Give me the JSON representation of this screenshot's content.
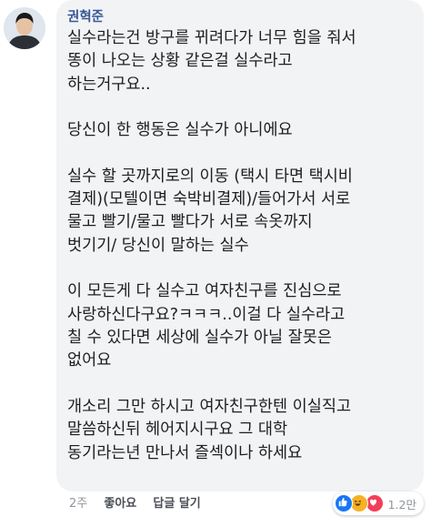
{
  "comment": {
    "author": "권혁준",
    "paragraphs": [
      [
        "실수라는건 방구를 뀌려다가 너무 힘을 줘서",
        "똥이 나오는 상황 같은걸 실수라고",
        "하는거구요.."
      ],
      [
        "당신이 한 행동은 실수가 아니에요"
      ],
      [
        "실수 할 곳까지로의 이동 (택시 타면 택시비",
        "결제)(모텔이면 숙박비결제)/들어가서 서로",
        "물고 빨기/물고 빨다가 서로 속옷까지",
        "벗기기/ 당신이 말하는 실수"
      ],
      [
        "이 모든게 다 실수고 여자친구를 진심으로",
        "사랑하신다구요?ㅋㅋㅋ..이걸 다 실수라고",
        "칠 수 있다면 세상에 실수가 아닐 잘못은",
        "없어요"
      ],
      [
        "개소리 그만 하시고 여자친구한텐 이실직고",
        "말씀하신뒤 헤어지시구요 그 대학",
        "동기라는년 만나서 즐섹이나 하세요"
      ]
    ]
  },
  "meta": {
    "time": "2주",
    "like_label": "좋아요",
    "reply_label": "답글 달기"
  },
  "reactions": {
    "icons": [
      "like-icon",
      "haha-icon",
      "love-icon"
    ],
    "count": "1.2만"
  },
  "colors": {
    "bubble": "#f2f3f5",
    "author": "#385898",
    "meta": "#90949c",
    "like_blue": "#1877f2",
    "haha_yellow": "#f7b125",
    "love_red": "#f33e58"
  }
}
